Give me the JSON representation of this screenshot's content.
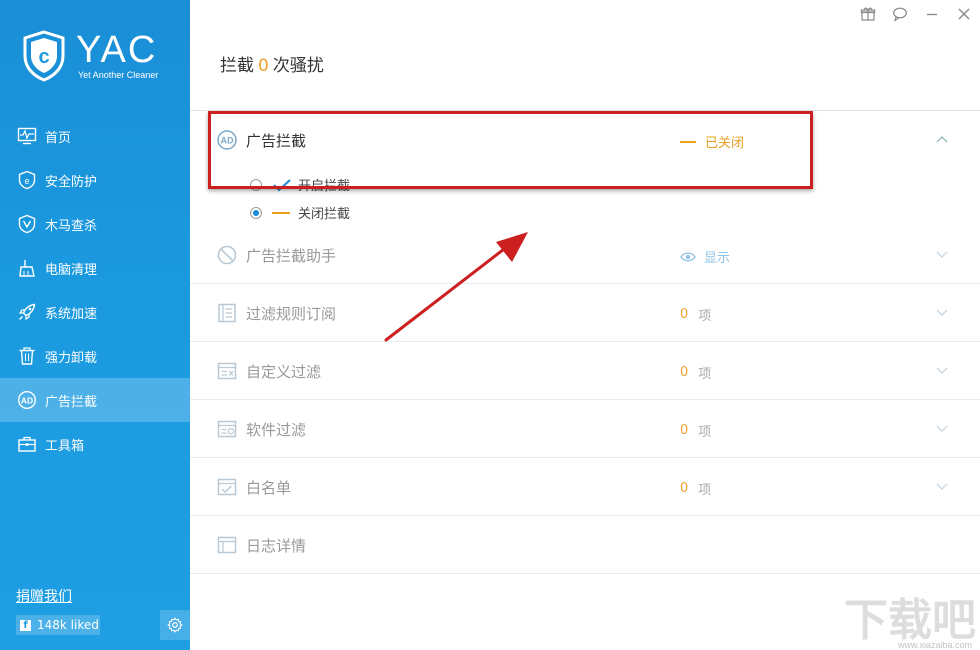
{
  "app": {
    "logo_text": "YAC",
    "logo_subtitle": "Yet Another Cleaner",
    "accent": "#1b9ae0",
    "highlight_color": "#f0a030"
  },
  "sidebar": {
    "items": [
      {
        "label": "首页",
        "icon": "monitor-pulse-icon"
      },
      {
        "label": "安全防护",
        "icon": "e-shield-icon"
      },
      {
        "label": "木马查杀",
        "icon": "shield-v-icon"
      },
      {
        "label": "电脑清理",
        "icon": "broom-icon"
      },
      {
        "label": "系统加速",
        "icon": "rocket-icon"
      },
      {
        "label": "强力卸载",
        "icon": "trash-icon"
      },
      {
        "label": "广告拦截",
        "icon": "ad-icon",
        "active": true
      },
      {
        "label": "工具箱",
        "icon": "toolbox-icon"
      }
    ],
    "donate": "捐赠我们",
    "facebook": "148k liked"
  },
  "header": {
    "prefix": "拦截",
    "count": "0",
    "suffix": "次骚扰"
  },
  "ad_block": {
    "label": "广告拦截",
    "status": "已关闭",
    "options": [
      {
        "label": "开启拦截",
        "selected": false
      },
      {
        "label": "关闭拦截",
        "selected": true
      }
    ]
  },
  "rows": [
    {
      "label": "广告拦截助手",
      "status": "显示",
      "icon": "no-entry-icon"
    },
    {
      "label": "过滤规则订阅",
      "count": "0",
      "unit": "项",
      "icon": "filter-list-icon"
    },
    {
      "label": "自定义过滤",
      "count": "0",
      "unit": "项",
      "icon": "custom-filter-icon"
    },
    {
      "label": "软件过滤",
      "count": "0",
      "unit": "项",
      "icon": "software-filter-icon"
    },
    {
      "label": "白名单",
      "count": "0",
      "unit": "项",
      "icon": "whitelist-icon"
    },
    {
      "label": "日志详情",
      "icon": "log-icon"
    }
  ],
  "watermark": {
    "text": "下载吧",
    "url": "www.xiazaiba.com"
  }
}
